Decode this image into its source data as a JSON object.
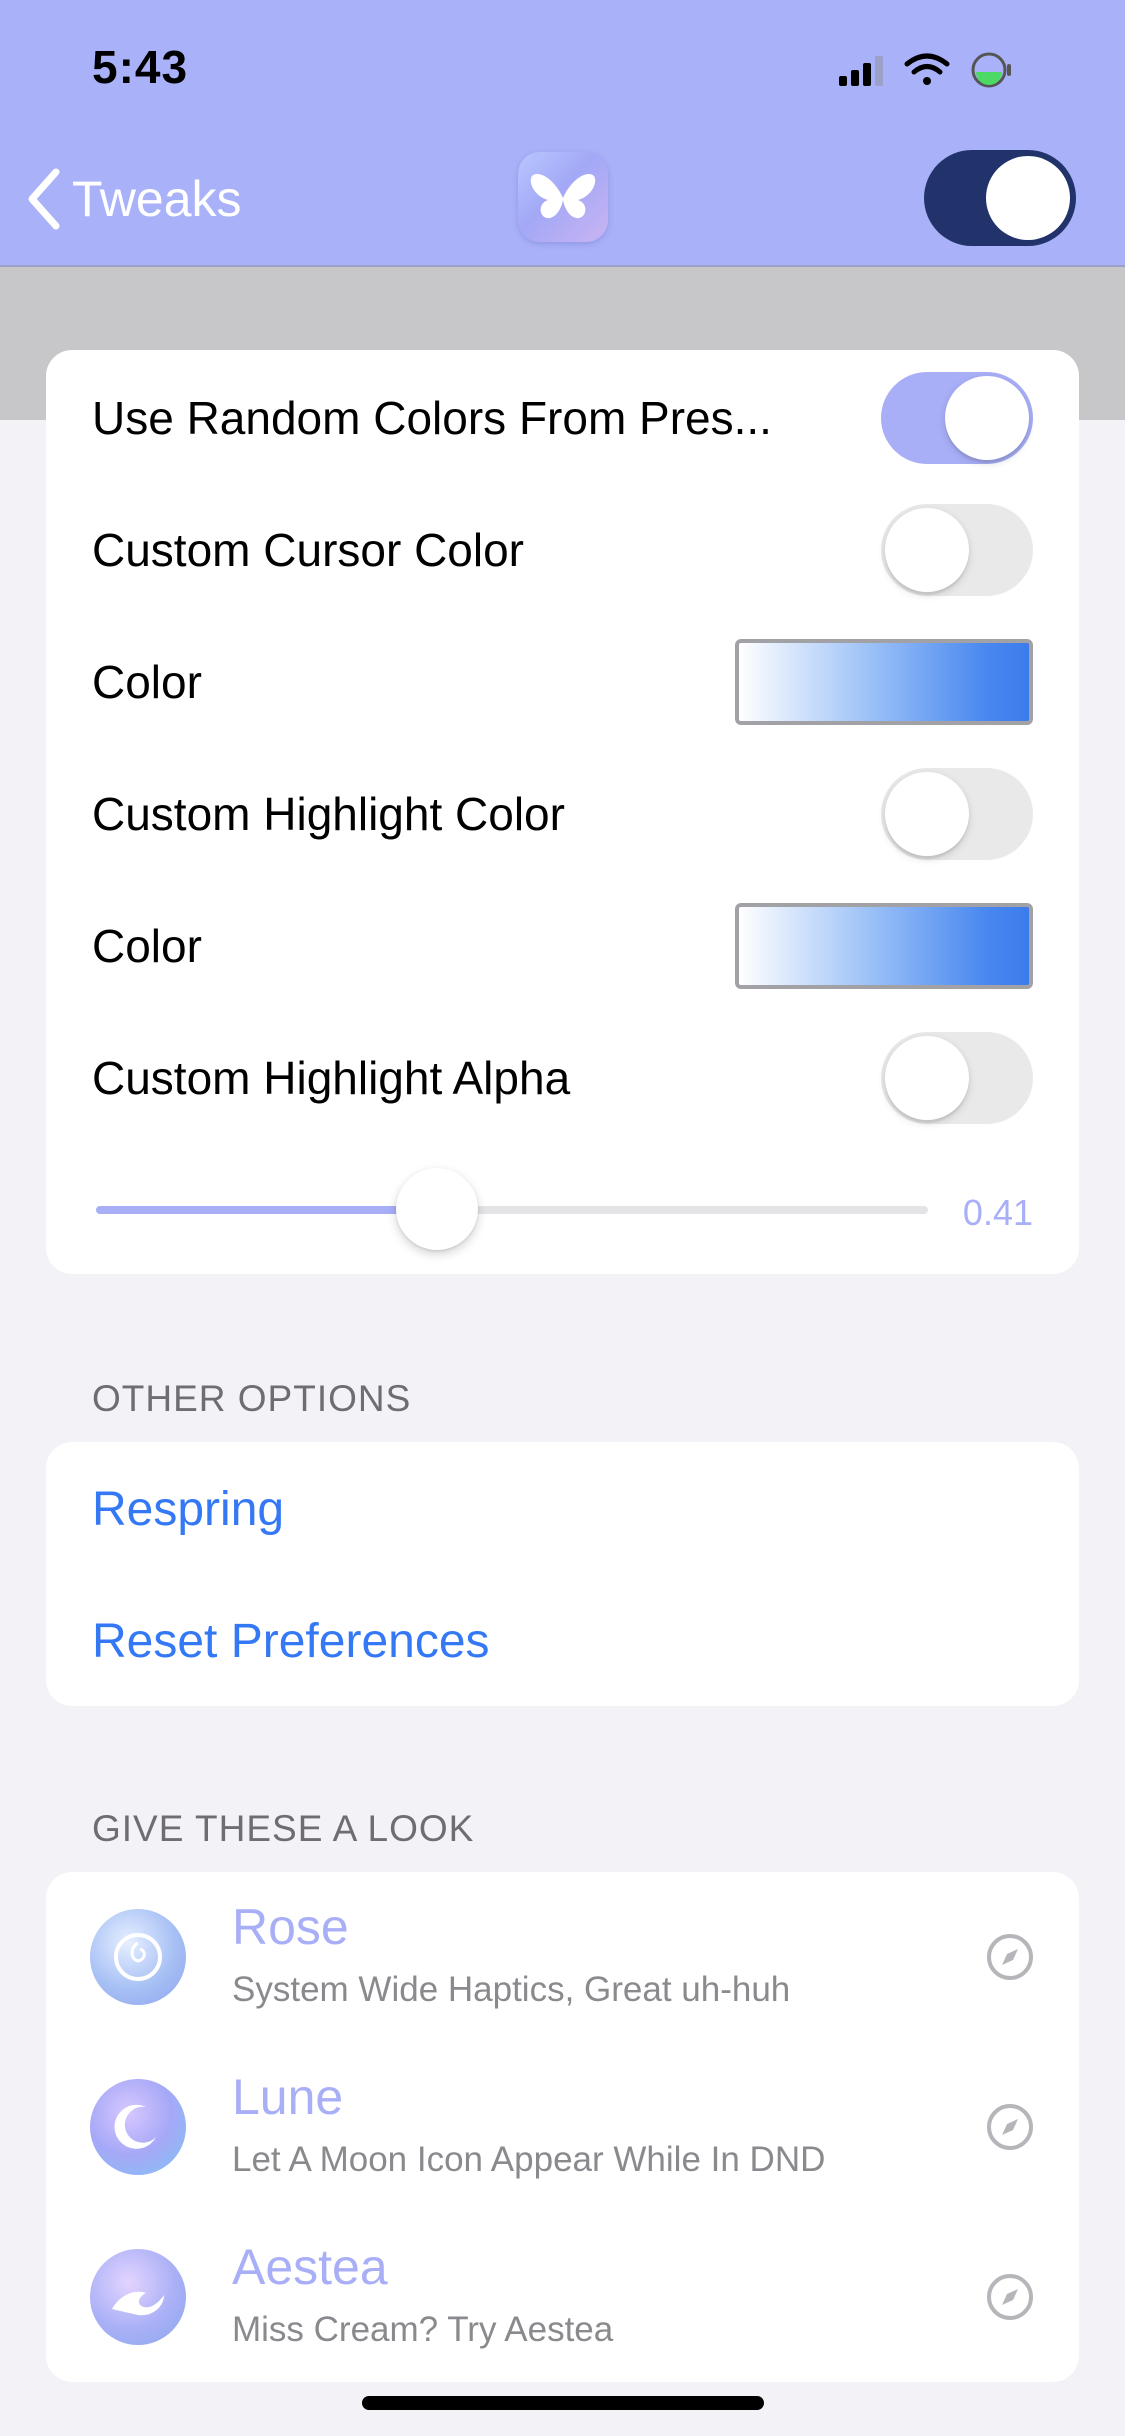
{
  "status_bar": {
    "time": "5:43",
    "icons": [
      "cellular-signal-icon",
      "wifi-icon",
      "battery-icon"
    ]
  },
  "nav": {
    "back_label": "Tweaks",
    "app_icon": "butterfly-icon",
    "master_toggle_on": true
  },
  "settings": {
    "rows": [
      {
        "label": "Use Random Colors From Pres...",
        "type": "toggle",
        "on": true
      },
      {
        "label": "Custom Cursor Color",
        "type": "toggle",
        "on": false
      },
      {
        "label": "Color",
        "type": "color-swatch"
      },
      {
        "label": "Custom Highlight Color",
        "type": "toggle",
        "on": false
      },
      {
        "label": "Color",
        "type": "color-swatch"
      },
      {
        "label": "Custom Highlight Alpha",
        "type": "toggle",
        "on": false
      }
    ],
    "alpha_slider": {
      "value": 0.41,
      "value_label": "0.41"
    }
  },
  "other_options": {
    "header": "OTHER OPTIONS",
    "items": [
      "Respring",
      "Reset Preferences"
    ]
  },
  "give_these_a_look": {
    "header": "GIVE THESE A LOOK",
    "items": [
      {
        "title": "Rose",
        "subtitle": "System Wide Haptics, Great uh-huh",
        "icon": "rose-icon"
      },
      {
        "title": "Lune",
        "subtitle": "Let A Moon Icon Appear While In DND",
        "icon": "moon-icon"
      },
      {
        "title": "Aestea",
        "subtitle": "Miss Cream? Try Aestea",
        "icon": "wave-icon"
      }
    ]
  },
  "colors": {
    "accent": "#a8aff7",
    "header_bg": "#a9b1f8",
    "link": "#3478f6",
    "toggle_dark": "#22336b"
  }
}
